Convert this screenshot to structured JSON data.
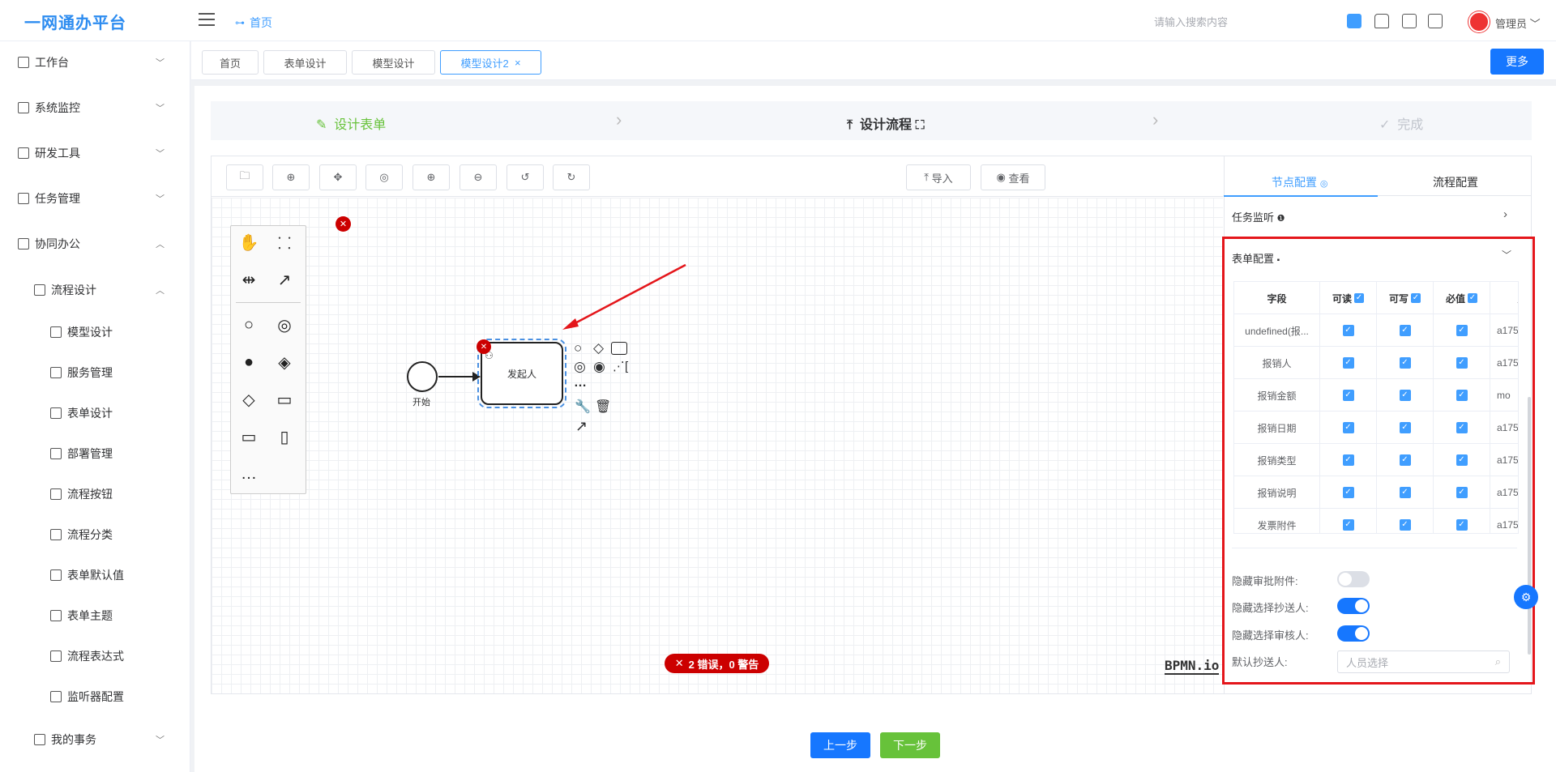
{
  "header": {
    "logo": "一网通办平台",
    "breadcrumb": "首页",
    "search_placeholder": "请输入搜索内容",
    "user": "管理员"
  },
  "sidebar": {
    "items": [
      {
        "label": "工作台",
        "icon": "monitor-icon",
        "chev": "﹀"
      },
      {
        "label": "系统监控",
        "icon": "bank-icon",
        "chev": "﹀"
      },
      {
        "label": "研发工具",
        "icon": "code-icon",
        "chev": "﹀"
      },
      {
        "label": "任务管理",
        "icon": "copy-icon",
        "chev": "﹀"
      },
      {
        "label": "协同办公",
        "icon": "send-icon",
        "chev": "︿"
      },
      {
        "label": "流程设计",
        "icon": "flow-icon",
        "chev": "︿"
      },
      {
        "label": "模型设计",
        "icon": "text-icon"
      },
      {
        "label": "服务管理",
        "icon": "gear-icon"
      },
      {
        "label": "表单设计",
        "icon": "form-icon"
      },
      {
        "label": "部署管理",
        "icon": "chart-icon"
      },
      {
        "label": "流程按钮",
        "icon": "gear-icon"
      },
      {
        "label": "流程分类",
        "icon": "flow-icon"
      },
      {
        "label": "表单默认值",
        "icon": "link-icon"
      },
      {
        "label": "表单主题",
        "icon": "calendar-icon"
      },
      {
        "label": "流程表达式",
        "icon": "flag-icon"
      },
      {
        "label": "监听器配置",
        "icon": "toggle-icon"
      },
      {
        "label": "我的事务",
        "icon": "bell-icon",
        "chev": "﹀"
      }
    ]
  },
  "tabs": [
    {
      "label": "首页"
    },
    {
      "label": "表单设计"
    },
    {
      "label": "模型设计"
    },
    {
      "label": "模型设计2",
      "close": "×"
    }
  ],
  "more_button": "更多",
  "steps": [
    {
      "label": "设计表单",
      "icon": "✎"
    },
    {
      "label": "设计流程",
      "icon": "⤒"
    },
    {
      "label": "完成",
      "icon": "✓"
    }
  ],
  "toolbar": {
    "import": "导入",
    "view": "查看"
  },
  "canvas": {
    "start_label": "开始",
    "task_label": "发起人",
    "error_badge": "2 错误，0 警告",
    "logo": "BPMN.io"
  },
  "panel": {
    "tab_node": "节点配置",
    "tab_flow": "流程配置",
    "task_listen": "任务监听",
    "form_config": "表单配置",
    "columns": [
      "字段",
      "可读",
      "可写",
      "必值",
      "属"
    ],
    "rows": [
      {
        "field": "undefined(报...",
        "prop": "a175"
      },
      {
        "field": "报销人",
        "prop": "a175"
      },
      {
        "field": "报销金额",
        "prop": "mo"
      },
      {
        "field": "报销日期",
        "prop": "a175"
      },
      {
        "field": "报销类型",
        "prop": "a175"
      },
      {
        "field": "报销说明",
        "prop": "a175"
      },
      {
        "field": "发票附件",
        "prop": "a175"
      }
    ],
    "switches": [
      {
        "label": "隐藏审批附件:",
        "on": false
      },
      {
        "label": "隐藏选择抄送人:",
        "on": true
      },
      {
        "label": "隐藏选择审核人:",
        "on": true
      }
    ],
    "default_cc_label": "默认抄送人:",
    "default_cc_placeholder": "人员选择"
  },
  "buttons": {
    "prev": "上一步",
    "next": "下一步"
  },
  "colors": {
    "primary": "#409eff",
    "error": "#cc0000",
    "highlight": "#e4161b",
    "step_done": "#67c23a",
    "next_button": "#67c23a"
  }
}
